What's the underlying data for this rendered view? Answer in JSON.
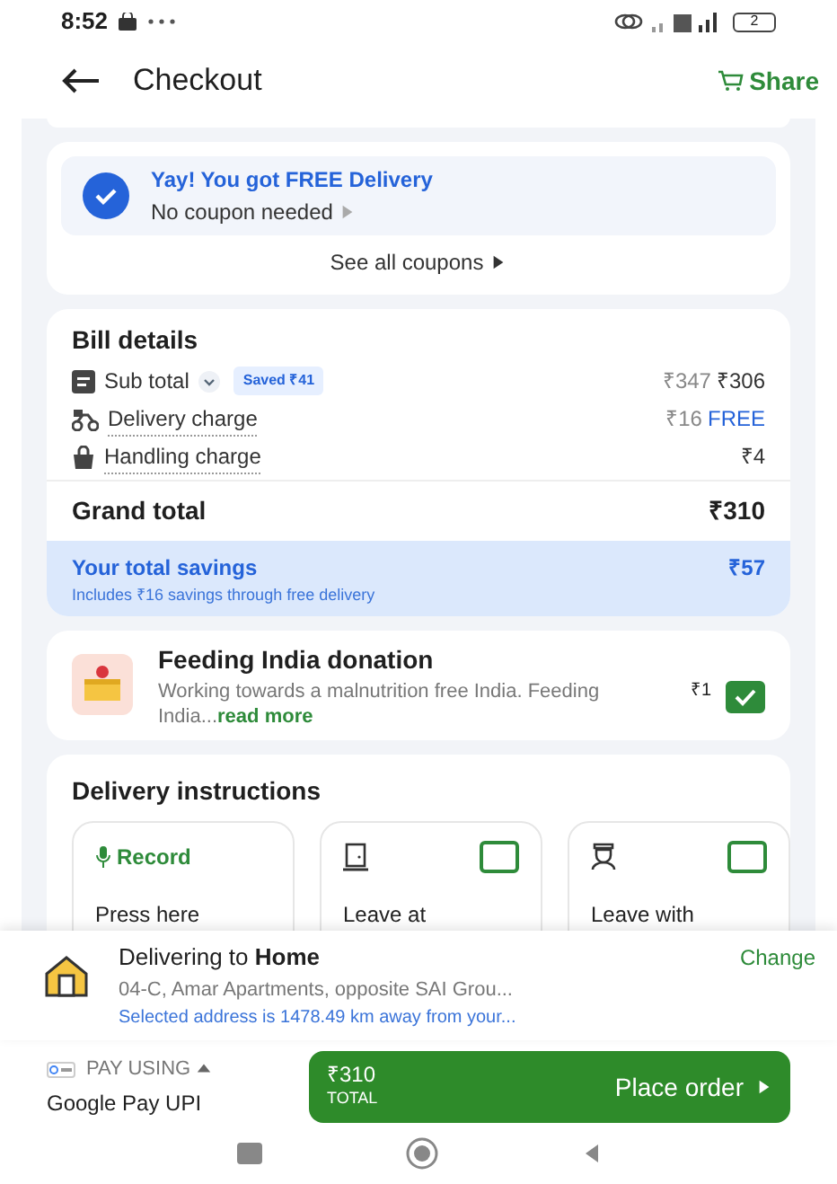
{
  "status_bar": {
    "time": "8:52",
    "battery": "2"
  },
  "header": {
    "title": "Checkout",
    "share": "Share"
  },
  "coupon": {
    "title": "Yay! You got FREE Delivery",
    "subtitle": "No coupon needed",
    "link": "See all coupons"
  },
  "bill": {
    "title": "Bill details",
    "rows": [
      {
        "kind": "subtotal",
        "label": "Sub total",
        "badge": "Saved ₹41",
        "original": "₹347",
        "value": "₹306"
      },
      {
        "kind": "delivery",
        "label": "Delivery charge",
        "original": "₹16",
        "value": "FREE"
      },
      {
        "kind": "handling",
        "label": "Handling charge",
        "value": "₹4"
      }
    ],
    "grand_total": {
      "label": "Grand total",
      "value": "₹310"
    },
    "savings": {
      "title": "Your total savings",
      "note": "Includes ₹16 savings through free delivery",
      "value": "₹57"
    }
  },
  "donation": {
    "title": "Feeding India donation",
    "text": "Working towards a malnutrition free India. Feeding India...",
    "link": "read more",
    "price": "₹1",
    "checked": true
  },
  "delivery_instructions": {
    "title": "Delivery instructions",
    "options": [
      {
        "kind": "record",
        "label": "Record",
        "text": "Press here"
      },
      {
        "kind": "door",
        "text": "Leave at",
        "checked": false
      },
      {
        "kind": "guard",
        "text": "Leave with",
        "checked": false
      }
    ]
  },
  "address": {
    "heading": "Delivering to **Home**",
    "line": "04-C, Amar Apartments, opposite SAI Grou...",
    "warning": "Selected address is 1478.49 km away from your...",
    "action": "Change"
  },
  "payment": {
    "label": "PAY USING",
    "method": "Google Pay UPI",
    "total": "₹310",
    "total_label": "TOTAL",
    "button": "Place order"
  }
}
